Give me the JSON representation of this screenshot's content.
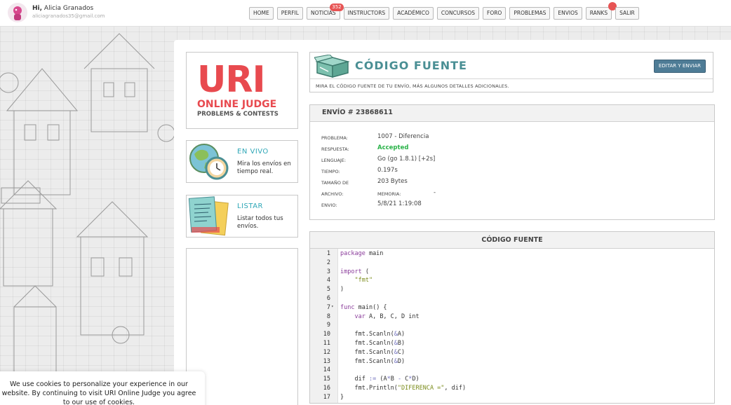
{
  "user": {
    "greeting": "Hi,",
    "name": "Alicia Granados",
    "email": "aliciagranados35@gmail.com"
  },
  "nav": [
    {
      "label": "HOME"
    },
    {
      "label": "PERFIL"
    },
    {
      "label": "NOTICIAS",
      "badge": "352"
    },
    {
      "label": "INSTRUCTORS"
    },
    {
      "label": "ACADÉMICO"
    },
    {
      "label": "CONCURSOS"
    },
    {
      "label": "FORO"
    },
    {
      "label": "PROBLEMAS"
    },
    {
      "label": "ENVIOS"
    },
    {
      "label": "RANKS"
    },
    {
      "label": "SALIR"
    }
  ],
  "logo": {
    "uri": "URI",
    "line1": "ONLINE JUDGE",
    "line2": "PROBLEMS & CONTESTS"
  },
  "sidebar": {
    "live": {
      "title": "EN VIVO",
      "desc": "Mira los envíos en tiempo real."
    },
    "list": {
      "title": "LISTAR",
      "desc": "Listar todos tus envíos."
    }
  },
  "header": {
    "title": "CÓDIGO FUENTE",
    "edit_button": "EDITAR Y ENVIAR",
    "subtitle": "MIRA EL CÓDIGO FUENTE DE TU ENVÍO, MÁS ALGUNOS DETALLES ADICIONALES."
  },
  "submission": {
    "heading": "ENVÍO # 23868611",
    "problem_label": "PROBLEMA:",
    "problem": "1007 - Diferencia",
    "answer_label": "RESPUESTA:",
    "answer": "Accepted",
    "language_label": "LENGUAJE:",
    "language": "Go (go 1.8.1) [+2s]",
    "time_label": "TIEMPO:",
    "time": "0.197s",
    "size_label": "TAMAÑO DE",
    "size": "203 Bytes",
    "file_label": "ARCHIVO:",
    "memory_label": "MEMORIA:",
    "memory": "-",
    "sent_label": "ENVIO:",
    "sent": "5/8/21 1:19:08"
  },
  "code": {
    "heading": "CÓDIGO FUENTE",
    "lines": [
      {
        "n": "1",
        "text": "package main"
      },
      {
        "n": "2",
        "text": ""
      },
      {
        "n": "3",
        "text": "import ("
      },
      {
        "n": "4",
        "text": "    \"fmt\""
      },
      {
        "n": "5",
        "text": ")"
      },
      {
        "n": "6",
        "text": ""
      },
      {
        "n": "7",
        "text": "func main() {"
      },
      {
        "n": "8",
        "text": "    var A, B, C, D int"
      },
      {
        "n": "9",
        "text": ""
      },
      {
        "n": "10",
        "text": "    fmt.Scanln(&A)"
      },
      {
        "n": "11",
        "text": "    fmt.Scanln(&B)"
      },
      {
        "n": "12",
        "text": "    fmt.Scanln(&C)"
      },
      {
        "n": "13",
        "text": "    fmt.Scanln(&D)"
      },
      {
        "n": "14",
        "text": ""
      },
      {
        "n": "15",
        "text": "    dif := (A*B - C*D)"
      },
      {
        "n": "16",
        "text": "    fmt.Println(\"DIFERENCA =\", dif)"
      },
      {
        "n": "17",
        "text": "}"
      }
    ]
  },
  "cookie": {
    "text": "We use cookies to personalize your experience in our website. By continuing to visit URI Online Judge you agree to our use of cookies."
  },
  "colors": {
    "accent_teal": "#4a8f94",
    "logo_red": "#e84a4f",
    "accepted_green": "#2bb34a",
    "badge_red": "#e75454",
    "edit_button_blue": "#4e7c96"
  }
}
